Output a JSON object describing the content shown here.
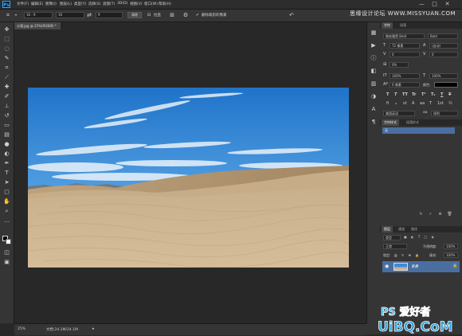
{
  "menubar": {
    "logo": "Ps",
    "items": [
      "文件(F)",
      "编辑(E)",
      "图像(I)",
      "图层(L)",
      "类型(Y)",
      "选择(S)",
      "滤镜(T)",
      "3D(D)",
      "视图(V)",
      "窗口(W)",
      "帮助(H)"
    ],
    "watermark": "思缘设计论坛  WWW.MISSYUAN.COM",
    "controls": [
      "—",
      "□",
      "✕"
    ]
  },
  "options": {
    "ratio": "16 : 9",
    "width": "16",
    "height": "9",
    "clear_label": "清除",
    "straighten_label": "拉直",
    "delete_cropped_label": "删除裁剪的像素",
    "delete_cropped_checked": true
  },
  "document": {
    "tab_title": "沙漠.jpg @ 25%(RGB/8) *",
    "zoom": "25%",
    "doc_info": "文档:24.1M/24.1M"
  },
  "character": {
    "tabs": [
      "字符",
      "段落"
    ],
    "font_family": "微软雅黑 Bold",
    "font_style": "Bold",
    "font_size": "72 像素",
    "leading": "(自动)",
    "kerning": "0",
    "tracking": "0",
    "vscale": "0%",
    "scale_v": "100%",
    "scale_h": "100%",
    "baseline": "0 像素",
    "color_label": "颜色:",
    "language": "美国英语",
    "aa": "aa",
    "aa_method": "锐利",
    "style_buttons": [
      "T",
      "T",
      "TT",
      "Tr",
      "T¹",
      "T₁",
      "T",
      "T"
    ],
    "opentype_buttons": [
      "fi",
      "ℴ",
      "st",
      "A",
      "aa",
      "T",
      "1st",
      "½"
    ]
  },
  "styles_panel": {
    "tabs": [
      "字符样式",
      "段落样式"
    ],
    "item": "无"
  },
  "layers": {
    "tabs": [
      "图层",
      "通道",
      "路径"
    ],
    "filter_label": "类型",
    "blend_mode": "正常",
    "opacity_label": "不透明度:",
    "opacity": "100%",
    "lock_label": "锁定:",
    "fill_label": "填充:",
    "fill": "100%",
    "items": [
      {
        "name": "背景",
        "visible": true
      }
    ]
  },
  "watermark_bottom": {
    "line1": "PS 爱好者",
    "line2": "UiBQ.CoM"
  },
  "colors": {
    "foreground": "#000000",
    "background": "#ffffff",
    "accent": "#4a6ea0"
  }
}
